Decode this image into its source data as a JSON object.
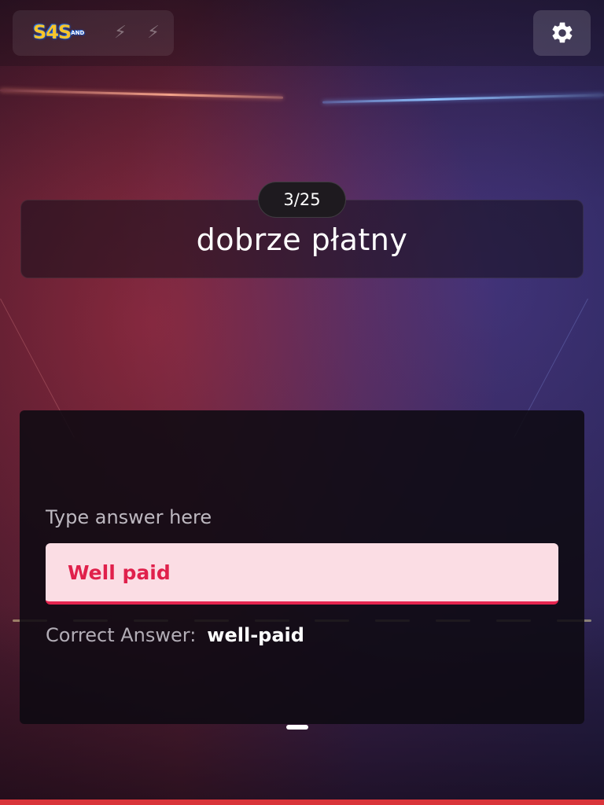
{
  "header": {
    "logo_text": "S4S",
    "logo_sub": "AND",
    "bolt_icons": [
      "bolt-icon",
      "bolt-icon"
    ],
    "settings_icon": "gear-icon"
  },
  "question": {
    "progress": "3/25",
    "word": "dobrze płatny"
  },
  "answer": {
    "label": "Type answer here",
    "user_answer": "Well paid",
    "correct_label": "Correct Answer:",
    "correct_value": "well-paid"
  },
  "colors": {
    "answer_text": "#e0204b",
    "answer_bg": "#fbdde4",
    "bottom_bar": "#d9343a"
  }
}
